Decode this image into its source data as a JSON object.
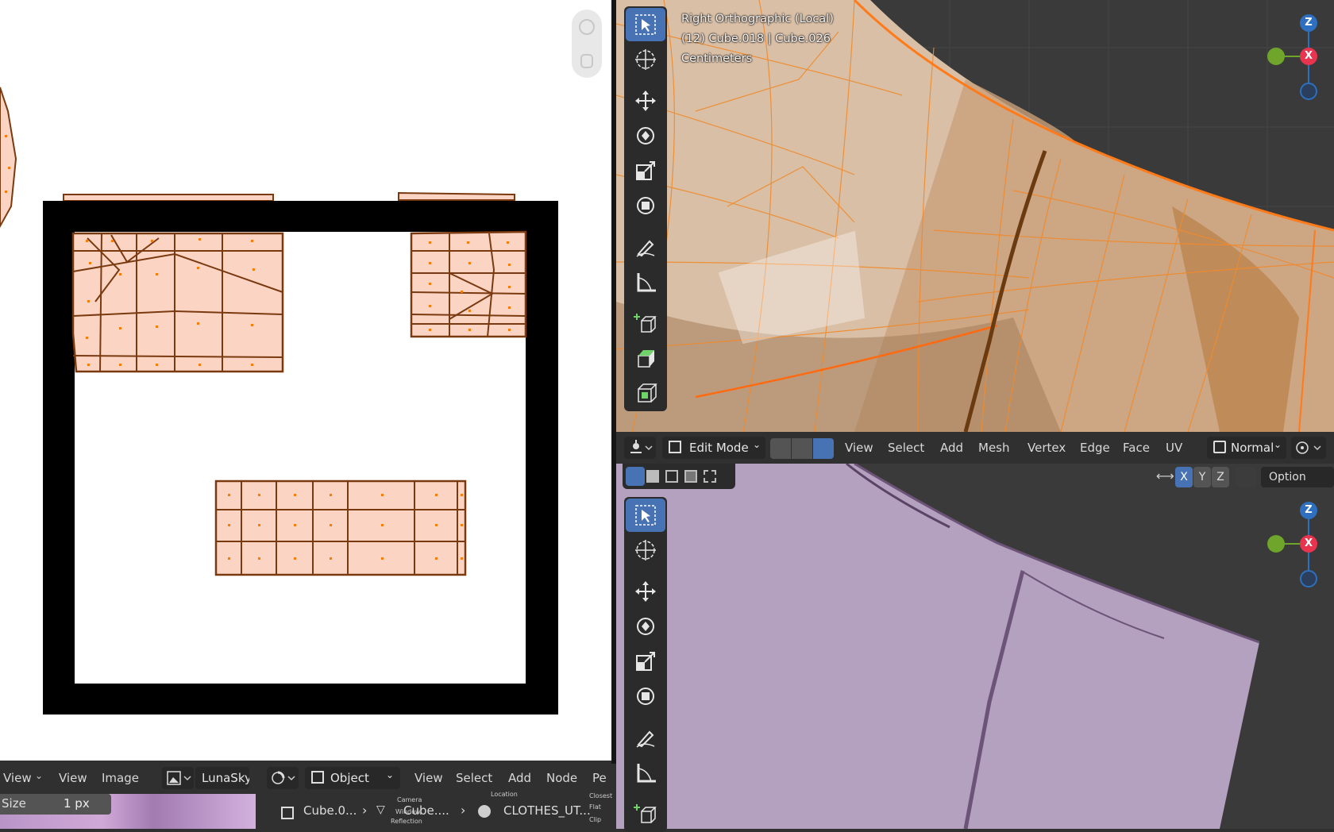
{
  "uv_editor": {
    "header": {
      "view_menu": "View",
      "view_label": "View",
      "image_label": "Image",
      "image_name": "LunaSky"
    },
    "size_field": {
      "label": "Size",
      "value": "1 px"
    }
  },
  "shader_editor": {
    "header": {
      "object_dropdown": "Object",
      "view_label": "View",
      "select_label": "Select",
      "add_label": "Add",
      "node_label": "Node",
      "truncated_label": "Pe"
    },
    "breadcrumbs": [
      "Cube.0...",
      "Cube....",
      "CLOTHES_UT..."
    ],
    "mini_labels": [
      "Camera",
      "Window",
      "Reflection",
      "Location",
      "Flat",
      "Clip",
      "Closest"
    ]
  },
  "viewport_top": {
    "overlay": {
      "view_name": "Right Orthographic (Local)",
      "object_info": "(12) Cube.018 | Cube.026",
      "units": "Centimeters"
    },
    "gizmo": {
      "z": "Z",
      "x": "X"
    }
  },
  "viewport_bottom": {
    "header": {
      "mode": "Edit Mode",
      "menus": [
        "View",
        "Select",
        "Add",
        "Mesh",
        "Vertex",
        "Edge",
        "Face",
        "UV"
      ],
      "orientation": "Normal",
      "mirror_axes": [
        "X",
        "Y",
        "Z"
      ],
      "options_label": "Option"
    },
    "gizmo": {
      "z": "Z",
      "x": "X"
    }
  },
  "tools": [
    "select-box",
    "cursor",
    "move",
    "rotate",
    "scale",
    "transform",
    "annotate",
    "measure",
    "add-cube",
    "extrude",
    "inset"
  ],
  "colors": {
    "accent_blue": "#4772b3",
    "uv_face_fill": "#fcd4c4",
    "uv_edge": "#7a3a10",
    "mesh_orange": "#f08a2c",
    "gizmo_x": "#e8344e",
    "gizmo_y": "#6ea52a",
    "gizmo_z": "#2e6fbf",
    "cloth_purple": "#b4a0bf"
  }
}
